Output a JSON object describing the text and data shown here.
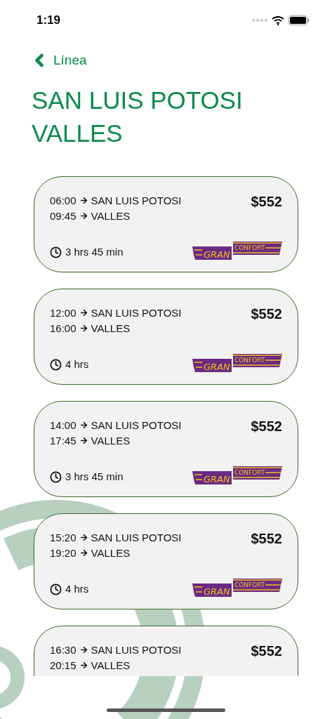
{
  "status_bar": {
    "time": "1:19"
  },
  "nav": {
    "back_label": "Línea"
  },
  "title": "SAN LUIS POTOSI VALLES",
  "trips": [
    {
      "departure": {
        "time": "06:00",
        "place": "SAN LUIS POTOSI"
      },
      "arrival": {
        "time": "09:45",
        "place": "VALLES"
      },
      "price": "$552",
      "duration": "3 hrs 45 min",
      "logo": [
        "GRAN",
        "CONFORT"
      ]
    },
    {
      "departure": {
        "time": "12:00",
        "place": "SAN LUIS POTOSI"
      },
      "arrival": {
        "time": "16:00",
        "place": "VALLES"
      },
      "price": "$552",
      "duration": "4 hrs",
      "logo": [
        "GRAN",
        "CONFORT"
      ]
    },
    {
      "departure": {
        "time": "14:00",
        "place": "SAN LUIS POTOSI"
      },
      "arrival": {
        "time": "17:45",
        "place": "VALLES"
      },
      "price": "$552",
      "duration": "3 hrs 45 min",
      "logo": [
        "GRAN",
        "CONFORT"
      ]
    },
    {
      "departure": {
        "time": "15:20",
        "place": "SAN LUIS POTOSI"
      },
      "arrival": {
        "time": "19:20",
        "place": "VALLES"
      },
      "price": "$552",
      "duration": "4 hrs",
      "logo": [
        "GRAN",
        "CONFORT"
      ]
    },
    {
      "departure": {
        "time": "16:30",
        "place": "SAN LUIS POTOSI"
      },
      "arrival": {
        "time": "20:15",
        "place": "VALLES"
      },
      "price": "$552"
    }
  ]
}
